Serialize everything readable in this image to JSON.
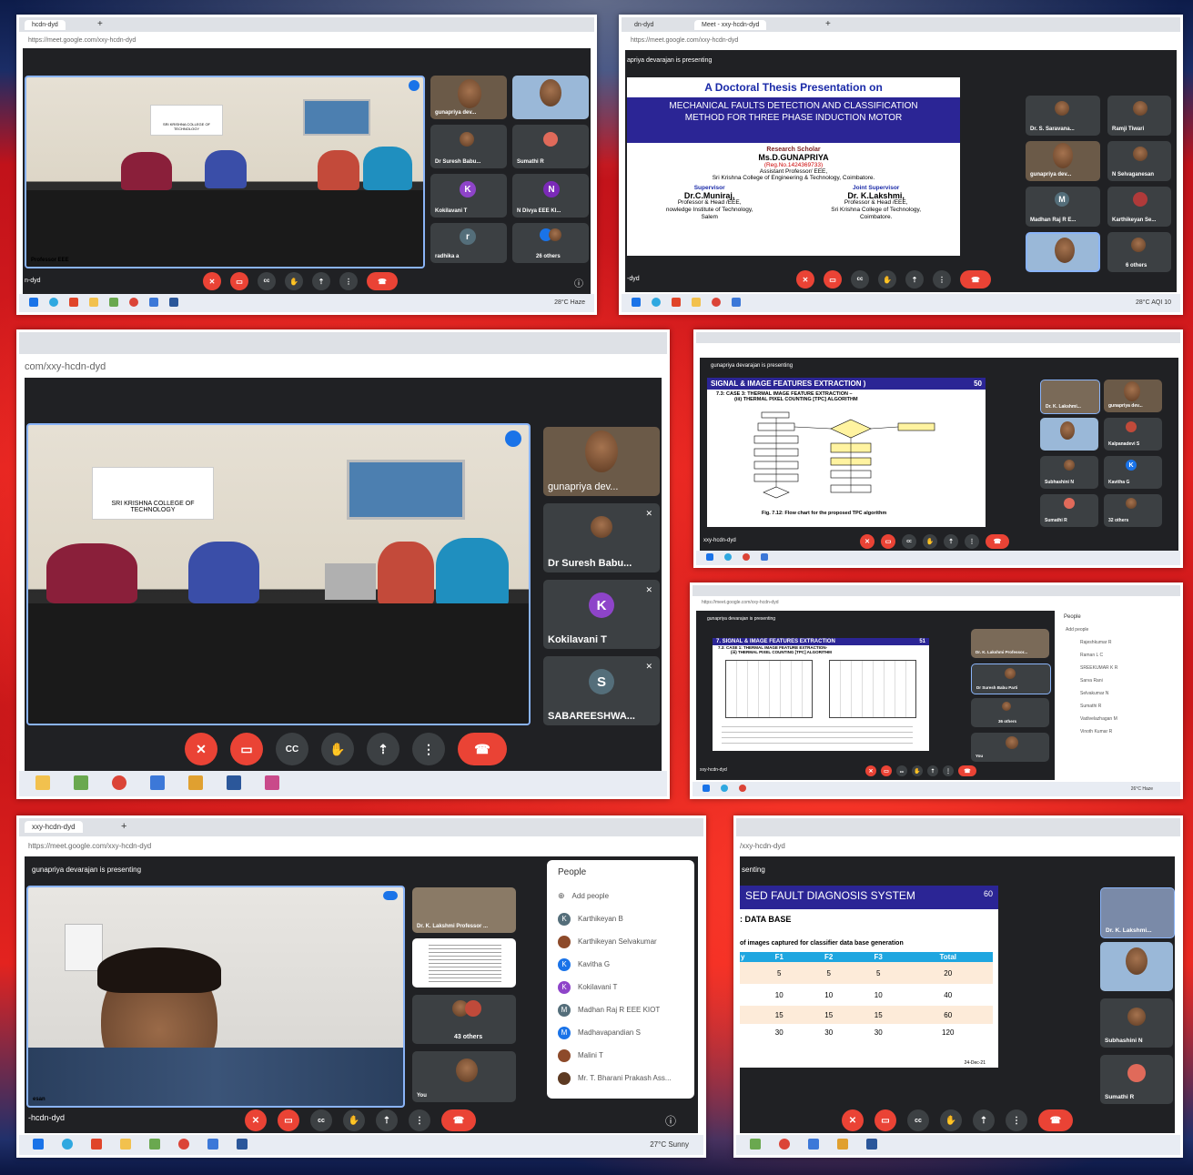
{
  "p1": {
    "tab": "hcdn-dyd",
    "url": "https://meet.google.com/xxy-hcdn-dyd",
    "room_sign": "SRI KRISHNA COLLEGE OF TECHNOLOGY",
    "main_label": "Professor EEE",
    "tiles": [
      "gunapriya dev...",
      "Dr Suresh Babu...",
      "Sumathi R",
      "Kokilavani T",
      "N Divya EEE KI...",
      "radhika a",
      "26 others"
    ],
    "tile_letters": {
      "k": "K",
      "n": "N",
      "r": "r"
    },
    "meeting_code": "n-dyd",
    "weather": "28°C Haze"
  },
  "p2": {
    "tab1": "dn-dyd",
    "tab2": "Meet - xxy-hcdn-dyd",
    "url": "https://meet.google.com/xxy-hcdn-dyd",
    "presenting": "apriya devarajan is presenting",
    "slide_title": "A Doctoral Thesis Presentation on",
    "slide_subtitle": "MECHANICAL FAULTS DETECTION AND CLASSIFICATION METHOD FOR THREE PHASE INDUCTION MOTOR",
    "scholar_label": "Research Scholar",
    "scholar_name": "Ms.D.GUNAPRIYA",
    "reg_no": "(Reg.No.1424369733)",
    "scholar_role": "Assistant Professor/ EEE,",
    "scholar_inst": "Sri Krishna College of Engineering & Technology, Coimbatore.",
    "sup_label": "Supervisor",
    "sup_name": "Dr.C.Muniraj,",
    "sup_role": "Professor & Head /EEE,",
    "sup_inst": "nowledge Institute of Technology,",
    "sup_city": "Salem",
    "jsup_label": "Joint Supervisor",
    "jsup_name": "Dr. K.Lakshmi,",
    "jsup_role": "Professor & Head /EEE,",
    "jsup_inst": "Sri Krishna College of Technology,",
    "jsup_city": "Coimbatore.",
    "tiles": [
      "Dr. S. Saravana...",
      "Ramji Tiwari",
      "gunapriya dev...",
      "N Selvaganesan",
      "Madhan Raj R E...",
      "Karthikeyan Se...",
      "",
      "6 others"
    ],
    "meeting_code": "-dyd",
    "weather": "28°C AQI 10"
  },
  "p3": {
    "url": "com/xxy-hcdn-dyd",
    "room_sign": "SRI KRISHNA COLLEGE OF TECHNOLOGY",
    "tiles": [
      "gunapriya dev...",
      "Dr Suresh Babu...",
      "Kokilavani T",
      "SABAREESHWA..."
    ],
    "letters": [
      "K",
      "S"
    ],
    "cc": "CC"
  },
  "p4": {
    "presenting": "gunapriya devarajan is presenting",
    "slide_header": "SIGNAL & IMAGE FEATURES EXTRACTION )",
    "slide_page": "50",
    "case": "7.3: CASE 3: THERMAL IMAGE FEATURE EXTRACTION –",
    "case2": "(iii) THERMAL PIXEL COUNTING [TPC] ALGORITHM",
    "caption": "Fig. 7.12: Flow chart for the proposed TPC algorithm",
    "tiles": [
      "Dr. K. Lakshmi...",
      "gunapriya dev...",
      "",
      "Kalpanadevi S",
      "Subhashini N",
      "Kavitha G",
      "Sumathi R",
      "32 others"
    ],
    "meeting_code": "xxy-hcdn-dyd"
  },
  "p5": {
    "url": "https://meet.google.com/xxy-hcdn-dyd",
    "presenting": "gunapriya devarajan is presenting",
    "slide_header": "7. SIGNAL & IMAGE FEATURES EXTRACTION",
    "slide_page": "51",
    "case": "7.3: CASE 1: THERMAL IMAGE FEATURE EXTRACTION-",
    "case2": "(iii) THERMAL PIXEL COUNTING [TPC] ALGORITHM",
    "tiles": [
      "Dr. K. Lakshmi Professor...",
      "Dr Suresh Babu Parti",
      "36 others",
      "You"
    ],
    "people_title": "People",
    "people": [
      "Add people",
      "Rajeshkumar R",
      "Raman L C",
      "SREEKUMAR K R",
      "Sarva Rani",
      "Selvakumar N",
      "Sumathi R",
      "Vadivelazhagan M",
      "Vinoth Kumar R"
    ],
    "meeting_code": "xxy-hcdn-dyd",
    "weather": "26°C Haze"
  },
  "p6": {
    "tab": "xxy-hcdn-dyd",
    "url": "https://meet.google.com/xxy-hcdn-dyd",
    "presenting": "gunapriya devarajan is presenting",
    "tiles": [
      "Dr. K. Lakshmi Professor ...",
      "",
      "43 others",
      "You"
    ],
    "main_label": "esan",
    "people_title": "People",
    "add_people": "Add people",
    "people": [
      {
        "letter": "K",
        "name": "Karthikeyan B",
        "color": "#546e7a"
      },
      {
        "letter": "",
        "name": "Karthikeyan Selvakumar",
        "color": "#8d4a2a"
      },
      {
        "letter": "K",
        "name": "Kavitha G",
        "color": "#1a73e8"
      },
      {
        "letter": "K",
        "name": "Kokilavani T",
        "color": "#8e44c9"
      },
      {
        "letter": "M",
        "name": "Madhan Raj R EEE KIOT",
        "color": "#546e7a"
      },
      {
        "letter": "M",
        "name": "Madhavapandian S",
        "color": "#1a73e8"
      },
      {
        "letter": "",
        "name": "Malini T",
        "color": "#8d4a2a"
      },
      {
        "letter": "",
        "name": "Mr. T. Bharani Prakash Ass...",
        "color": "#5d3a22"
      }
    ],
    "meeting_code": "-hcdn-dyd",
    "weather": "27°C Sunny"
  },
  "p7": {
    "url": "/xxy-hcdn-dyd",
    "presenting": "senting",
    "slide_header": "SED FAULT DIAGNOSIS SYSTEM",
    "slide_page": "60",
    "section": ": DATA BASE",
    "desc": "of images captured for classifier data base generation",
    "table_head": [
      "y",
      "F1",
      "F2",
      "F3",
      "Total"
    ],
    "table_rows": [
      [
        "",
        "5",
        "5",
        "5",
        "20"
      ],
      [
        "",
        "10",
        "10",
        "10",
        "40"
      ],
      [
        "",
        "15",
        "15",
        "15",
        "60"
      ],
      [
        "",
        "30",
        "30",
        "30",
        "120"
      ]
    ],
    "date": "24-Dec-21",
    "tiles": [
      "Dr. K. Lakshmi...",
      "",
      "Subhashini N",
      "Sumathi R"
    ]
  }
}
